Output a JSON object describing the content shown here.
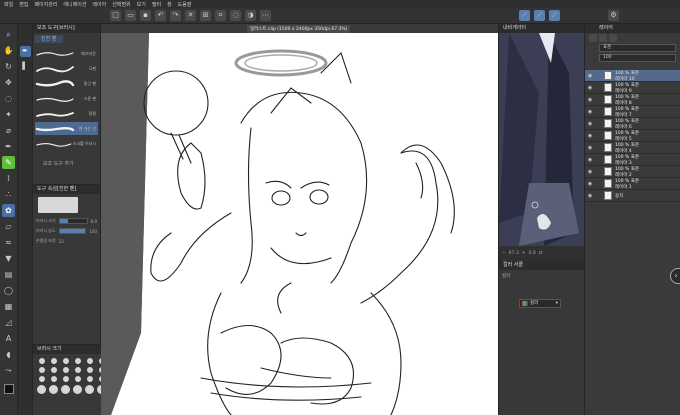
{
  "menu": [
    "파일",
    "편집",
    "페이지관리",
    "애니메이션",
    "레이어",
    "선택범위",
    "보기",
    "필터",
    "창",
    "도움말"
  ],
  "document_tab": "일러스트.clip (1500 x 2400px 350dpi 67.3%)",
  "tool_icons": [
    "zoom-icon",
    "hand-icon",
    "rotate-icon",
    "move-icon",
    "lasso-icon",
    "magic-wand-icon",
    "eyedropper-icon",
    "pen-icon",
    "pencil-icon",
    "brush-icon",
    "airbrush-icon",
    "decoration-icon",
    "eraser-icon",
    "blend-icon",
    "fill-icon",
    "gradient-icon",
    "figure-icon",
    "frame-icon",
    "ruler-icon",
    "text-icon",
    "balloon-icon",
    "correct-line-icon"
  ],
  "brush_panel": {
    "title": "보조 도구[브러시]",
    "active_tab": "진한 펜",
    "brushes": [
      {
        "label": "매끄러운"
      },
      {
        "label": "G펜"
      },
      {
        "label": "둥근 펜"
      },
      {
        "label": "스푼 펜"
      },
      {
        "label": "찰필"
      },
      {
        "label": "펜 가는 선"
      },
      {
        "label": "스크롤 브러시"
      }
    ],
    "footer": "보조 도구 추가"
  },
  "tool_property": {
    "title": "도구 속성[진한 펜]",
    "rows": [
      {
        "label": "브러시 크기",
        "value": "6.0"
      },
      {
        "label": "브러시 농도",
        "value": "100"
      },
      {
        "label": "손떨림 보정",
        "value": "12"
      }
    ],
    "size_fraction": 0.3,
    "density_fraction": 1.0
  },
  "palette": {
    "title": "브러시 크기",
    "sizes": [
      "0.7",
      "1",
      "1.5",
      "2",
      "2.5",
      "3",
      "4",
      "5",
      "6",
      "7",
      "8",
      "10",
      "12",
      "15",
      "17",
      "20",
      "25",
      "30",
      "40",
      "50",
      "60",
      "70",
      "80",
      "100"
    ]
  },
  "navigator": {
    "title": "내비게이터",
    "zoom": "67.3",
    "angle": "0.0"
  },
  "color_panel": {
    "title": "컬러 서클",
    "field_label": "컬러",
    "dropdown": "컬러"
  },
  "layer_panel": {
    "title": "레이어",
    "blend_mode": "표준",
    "opacity": "100",
    "layers": [
      {
        "name": "100 % 표준",
        "sub": "레이어 10",
        "selected": true
      },
      {
        "name": "100 % 표준",
        "sub": "레이어 9",
        "selected": false
      },
      {
        "name": "100 % 표준",
        "sub": "레이어 8",
        "selected": false
      },
      {
        "name": "100 % 표준",
        "sub": "레이어 7",
        "selected": false
      },
      {
        "name": "100 % 표준",
        "sub": "레이어 6",
        "selected": false
      },
      {
        "name": "100 % 표준",
        "sub": "레이어 5",
        "selected": false
      },
      {
        "name": "100 % 표준",
        "sub": "레이어 4",
        "selected": false
      },
      {
        "name": "100 % 표준",
        "sub": "레이어 3",
        "selected": false
      },
      {
        "name": "100 % 표준",
        "sub": "레이어 2",
        "selected": false
      },
      {
        "name": "100 % 표준",
        "sub": "레이어 1",
        "selected": false
      },
      {
        "name": "용지",
        "sub": "",
        "selected": false
      }
    ]
  }
}
